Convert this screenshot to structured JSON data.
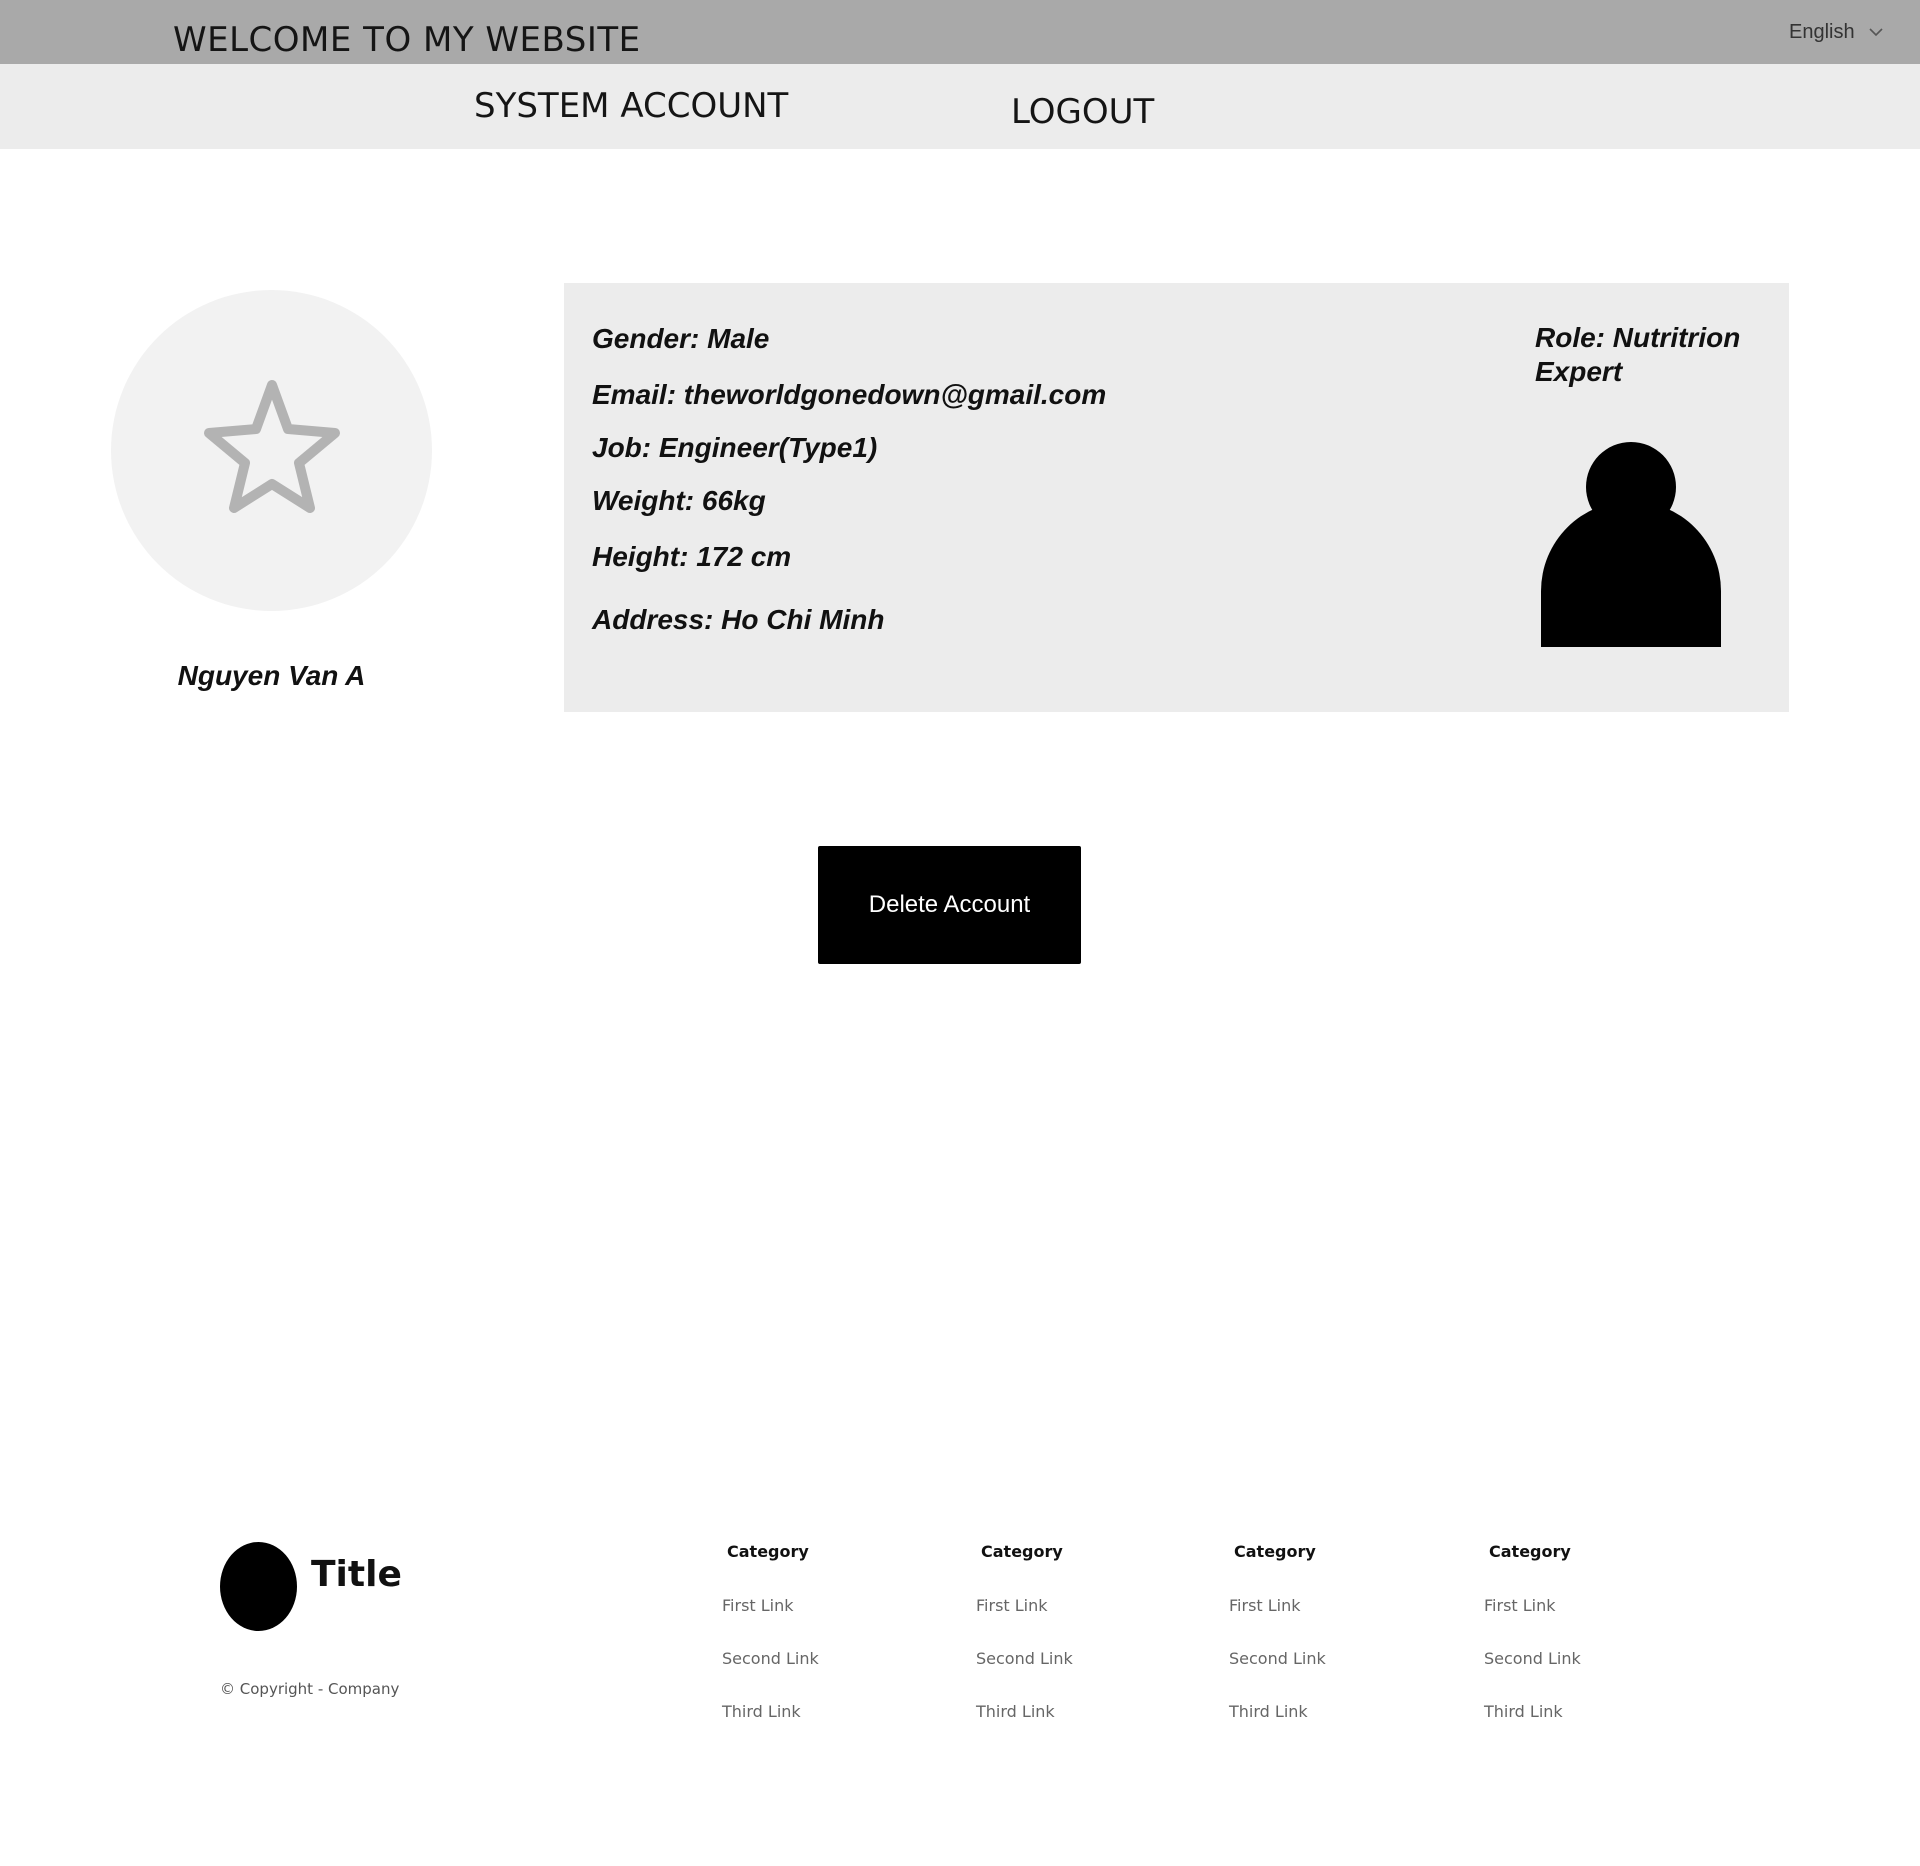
{
  "header": {
    "site_title": "WELCOME TO MY WEBSITE",
    "language": {
      "selected": "English",
      "icon": "chevron-down-icon"
    }
  },
  "nav": {
    "system_account": "SYSTEM ACCOUNT",
    "logout": "LOGOUT"
  },
  "profile": {
    "avatar_icon": "star-icon",
    "name": "Nguyen Van A",
    "gender": "Gender: Male",
    "email": "Email: theworldgonedown@gmail.com",
    "job": "Job: Engineer(Type1)",
    "weight": "Weight: 66kg",
    "height": "Height: 172 cm",
    "address": "Address: Ho Chi Minh",
    "role": "Role: Nutritrion Expert",
    "role_icon": "person-icon"
  },
  "actions": {
    "delete_account": "Delete Account"
  },
  "footer": {
    "title": "Title",
    "copyright": "© Copyright - Company",
    "columns": [
      {
        "category": "Category",
        "links": [
          "First Link",
          "Second Link",
          "Third Link"
        ]
      },
      {
        "category": "Category",
        "links": [
          "First Link",
          "Second Link",
          "Third Link"
        ]
      },
      {
        "category": "Category",
        "links": [
          "First Link",
          "Second Link",
          "Third Link"
        ]
      },
      {
        "category": "Category",
        "links": [
          "First Link",
          "Second Link",
          "Third Link"
        ]
      }
    ]
  },
  "colors": {
    "topbar": "#a9a9a9",
    "navbar": "#ececec",
    "panel": "#ececec",
    "button": "#000000"
  }
}
